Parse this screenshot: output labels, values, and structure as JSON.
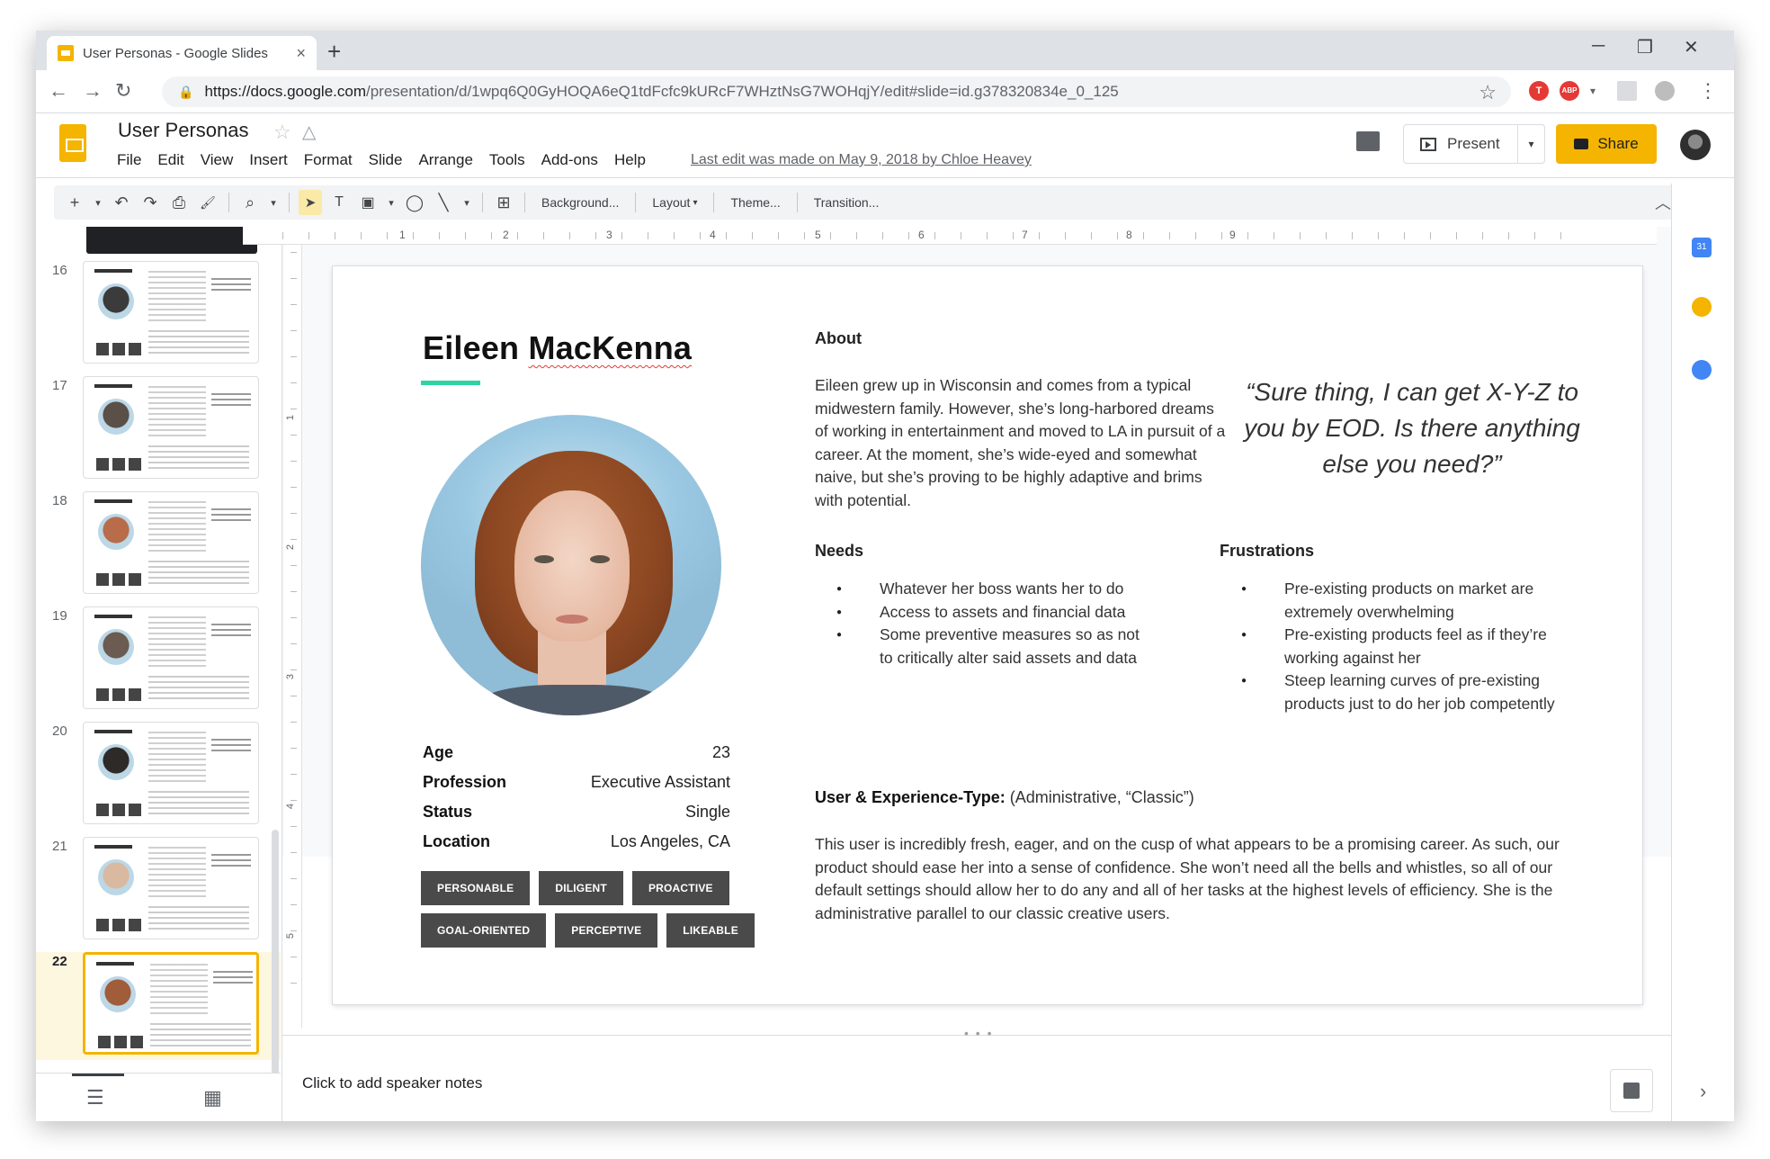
{
  "browser": {
    "tab_title": "User Personas - Google Slides",
    "tab_close": "×",
    "new_tab": "+",
    "url_host": "https://docs.google.com",
    "url_path": "/presentation/d/1wpq6Q0GyHOQA6eQ1tdFcfc9kURcF7WHztNsG7WOHqjY/edit#slide=id.g378320834e_0_125",
    "minimize": "─",
    "restore": "❐",
    "close": "✕",
    "back": "←",
    "forward": "→",
    "reload": "↻",
    "lock": "🔒",
    "bookmark": "☆",
    "ext_abp": "ABP",
    "ext_t": "T",
    "menu": "⋮"
  },
  "header": {
    "title": "User Personas",
    "star": "☆",
    "menu_items": [
      "File",
      "Edit",
      "View",
      "Insert",
      "Format",
      "Slide",
      "Arrange",
      "Tools",
      "Add-ons",
      "Help"
    ],
    "last_edit": "Last edit was made on May 9, 2018 by Chloe Heavey",
    "present_label": "Present",
    "present_dd": "▾",
    "share_label": "Share"
  },
  "toolbar": {
    "new_slide": "+",
    "dd": "▾",
    "undo": "↶",
    "redo": "↷",
    "print": "⎙",
    "paint": "🖌",
    "zoom": "⌕",
    "select": "➤",
    "textbox": "T",
    "image": "▣",
    "shape": "◯",
    "line": "╲",
    "comment_add": "⊞",
    "background": "Background...",
    "layout": "Layout",
    "theme": "Theme...",
    "transition": "Transition...",
    "collapse": "︿"
  },
  "ruler": {
    "h_numbers": [
      "1",
      "2",
      "3",
      "4",
      "5",
      "6",
      "7",
      "8",
      "9"
    ],
    "v_numbers": [
      "1",
      "2",
      "3",
      "4",
      "5"
    ]
  },
  "filmstrip": {
    "slides": [
      {
        "num": "16",
        "face": "#3b3b3b"
      },
      {
        "num": "17",
        "face": "#5a5048"
      },
      {
        "num": "18",
        "face": "#b86c4a"
      },
      {
        "num": "19",
        "face": "#6b5b50"
      },
      {
        "num": "20",
        "face": "#2e2a28"
      },
      {
        "num": "21",
        "face": "#d9b9a0"
      },
      {
        "num": "22",
        "face": "#a15c3a",
        "active": true
      }
    ],
    "list_view_icon": "☰",
    "grid_view_icon": "▦"
  },
  "slide": {
    "name_first": "Eileen ",
    "name_last": "MacKenna",
    "facts": [
      {
        "label": "Age",
        "value": "23"
      },
      {
        "label": "Profession",
        "value": "Executive Assistant"
      },
      {
        "label": "Status",
        "value": "Single"
      },
      {
        "label": "Location",
        "value": "Los Angeles, CA"
      }
    ],
    "tags_row1": [
      "PERSONABLE",
      "DILIGENT",
      "PROACTIVE"
    ],
    "tags_row2": [
      "GOAL-ORIENTED",
      "PERCEPTIVE",
      "LIKEABLE"
    ],
    "about_heading": "About",
    "about_text": "Eileen grew up in Wisconsin and comes from a typical midwestern family. However, she’s long-harbored dreams of working in entertainment and moved to LA in pursuit of a career. At the moment, she’s wide-eyed and somewhat naive, but she’s proving to be highly adaptive and brims with potential.",
    "quote": "“Sure thing, I can get X-Y-Z to you by EOD. Is there anything else you need?”",
    "needs_heading": "Needs",
    "needs": [
      "Whatever her boss wants her to do",
      "Access to assets and financial data",
      "Some preventive measures so as not to critically alter said assets and data"
    ],
    "frustrations_heading": "Frustrations",
    "frustrations": [
      "Pre-existing products on market are extremely overwhelming",
      "Pre-existing products feel as if they’re working against her",
      "Steep learning curves of pre-existing products just to do her job competently"
    ],
    "ux_label": "User & Experience-Type:",
    "ux_value": " (Administrative, “Classic”)",
    "summary": "This user is incredibly fresh, eager, and on the cusp of what appears to be a promising career. As such, our product should ease her into a sense of confidence. She won’t need all the bells and whistles, so all of our default settings should allow her to do any and all of her tasks at the highest levels of efficiency. She is the administrative parallel to our classic creative users."
  },
  "notes": {
    "placeholder": "Click to add speaker notes",
    "dots": "• • •",
    "side_chevron": "›"
  },
  "side_panel": {
    "calendar_text": "31"
  },
  "colors": {
    "brand_yellow": "#f4b400",
    "accent_teal": "#2fd3a3",
    "tag_bg": "#4a4a4a"
  }
}
